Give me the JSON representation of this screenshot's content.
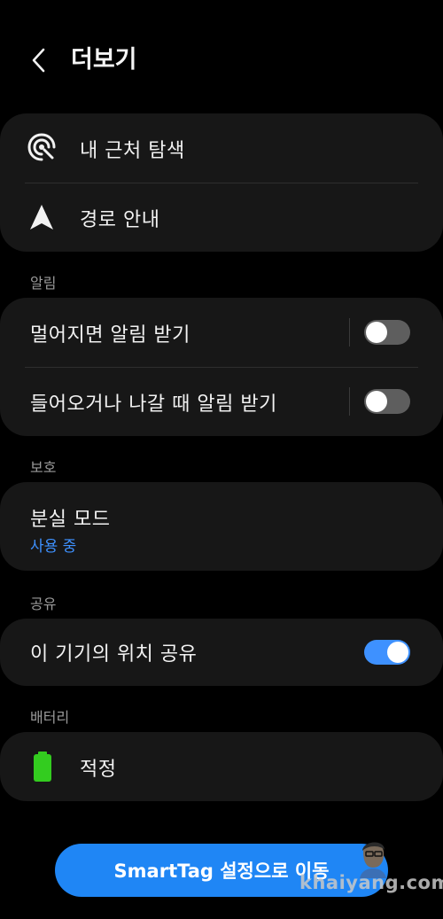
{
  "header": {
    "title": "더보기",
    "back_icon": "chevron-left-icon"
  },
  "nearby_card": {
    "items": [
      {
        "label": "내 근처 탐색",
        "icon": "nearby-scan-icon"
      },
      {
        "label": "경로 안내",
        "icon": "navigation-arrow-icon"
      }
    ]
  },
  "alerts_section": {
    "title": "알림",
    "items": [
      {
        "label": "멀어지면 알림 받기",
        "toggle": "off"
      },
      {
        "label": "들어오거나 나갈 때 알림 받기",
        "toggle": "off"
      }
    ]
  },
  "protection_section": {
    "title": "보호",
    "lost_mode": {
      "label": "분실 모드",
      "status": "사용 중"
    }
  },
  "share_section": {
    "title": "공유",
    "share_location": {
      "label": "이 기기의 위치 공유",
      "toggle": "on"
    }
  },
  "battery_section": {
    "title": "배터리",
    "battery": {
      "label": "적정",
      "icon": "battery-full-icon",
      "color": "#33cc1f"
    }
  },
  "cta": {
    "label": "SmartTag 설정으로 이동"
  },
  "watermark": {
    "text": "khaiyang.com"
  },
  "colors": {
    "accent": "#3e91ff",
    "cta_background": "#1f86f5",
    "card_background": "#171717",
    "page_background": "#000000"
  }
}
